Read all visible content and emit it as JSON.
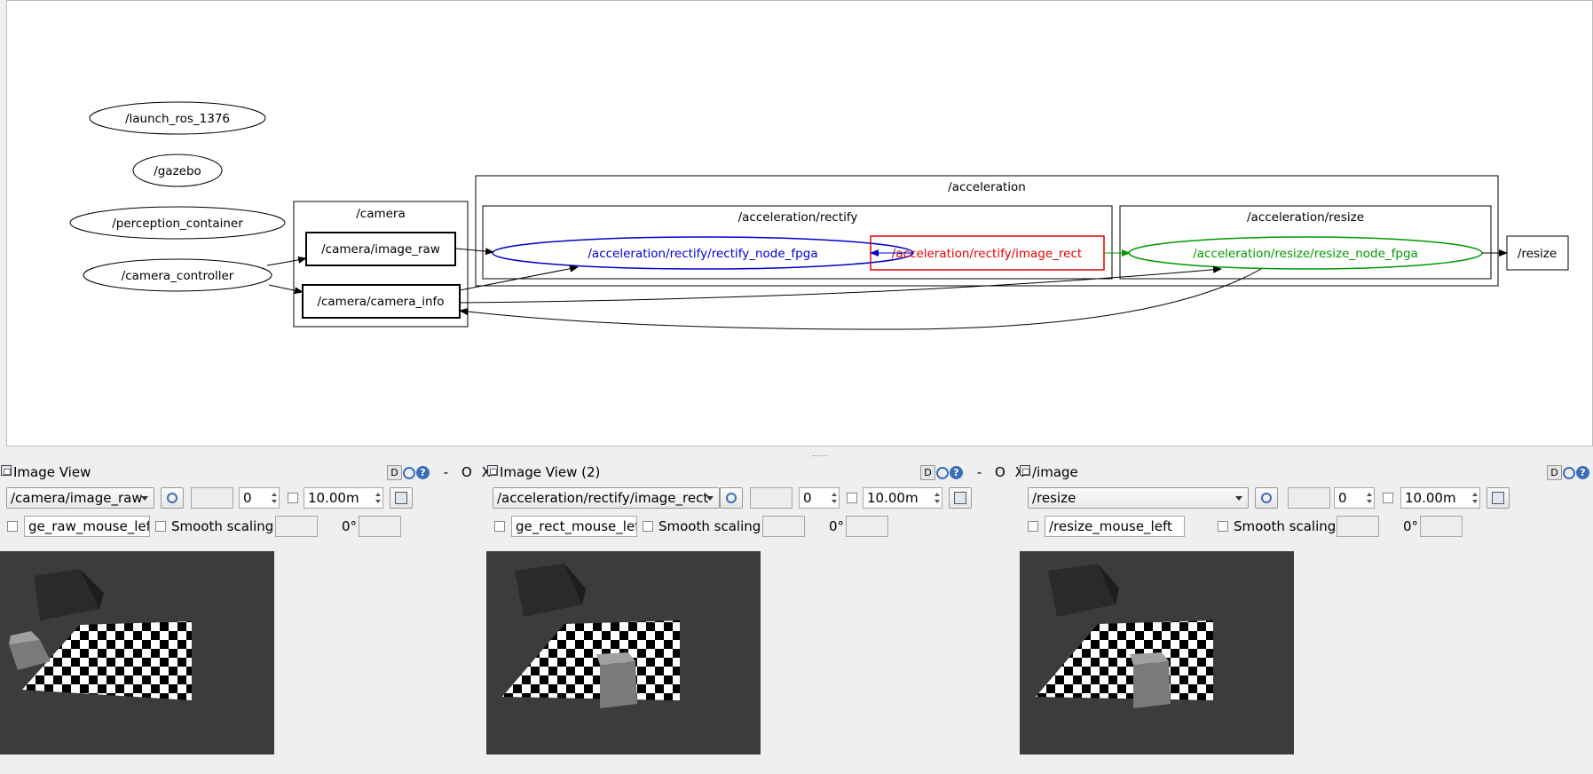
{
  "graph": {
    "nodes": {
      "launch_ros": "/launch_ros_1376",
      "gazebo": "/gazebo",
      "perception_container": "/perception_container",
      "camera_controller": "/camera_controller",
      "camera_group": "/camera",
      "camera_image_raw": "/camera/image_raw",
      "camera_camera_info": "/camera/camera_info",
      "acceleration_group": "/acceleration",
      "rectify_group": "/acceleration/rectify",
      "rectify_node": "/acceleration/rectify/rectify_node_fpga",
      "image_rect": "/acceleration/rectify/image_rect",
      "resize_group": "/acceleration/resize",
      "resize_node": "/acceleration/resize/resize_node_fpga",
      "resize_topic": "/resize"
    },
    "colors": {
      "rectify": "#0000cc",
      "image_rect": "#e00000",
      "resize": "#009900"
    }
  },
  "panels": [
    {
      "title": "Image View",
      "dock_buttons": {
        "d": "D",
        "help": "?",
        "min": "-",
        "float": "O",
        "close": "X"
      },
      "topic": "/camera/image_raw",
      "spin_value": "0",
      "period": "10.00m",
      "mouse_topic": "ge_raw_mouse_left",
      "smooth_label": "Smooth scaling",
      "rotation": "0°"
    },
    {
      "title": "Image View (2)",
      "dock_buttons": {
        "d": "D",
        "help": "?",
        "min": "-",
        "float": "O",
        "close": "X"
      },
      "topic": "/acceleration/rectify/image_rect",
      "spin_value": "0",
      "period": "10.00m",
      "mouse_topic": "ge_rect_mouse_left",
      "smooth_label": "Smooth scaling",
      "rotation": "0°"
    },
    {
      "title": "/image",
      "dock_buttons": {
        "d": "D",
        "help": "?"
      },
      "topic": "/resize",
      "spin_value": "0",
      "period": "10.00m",
      "mouse_topic": "/resize_mouse_left",
      "smooth_label": "Smooth scaling",
      "rotation": "0°"
    }
  ]
}
